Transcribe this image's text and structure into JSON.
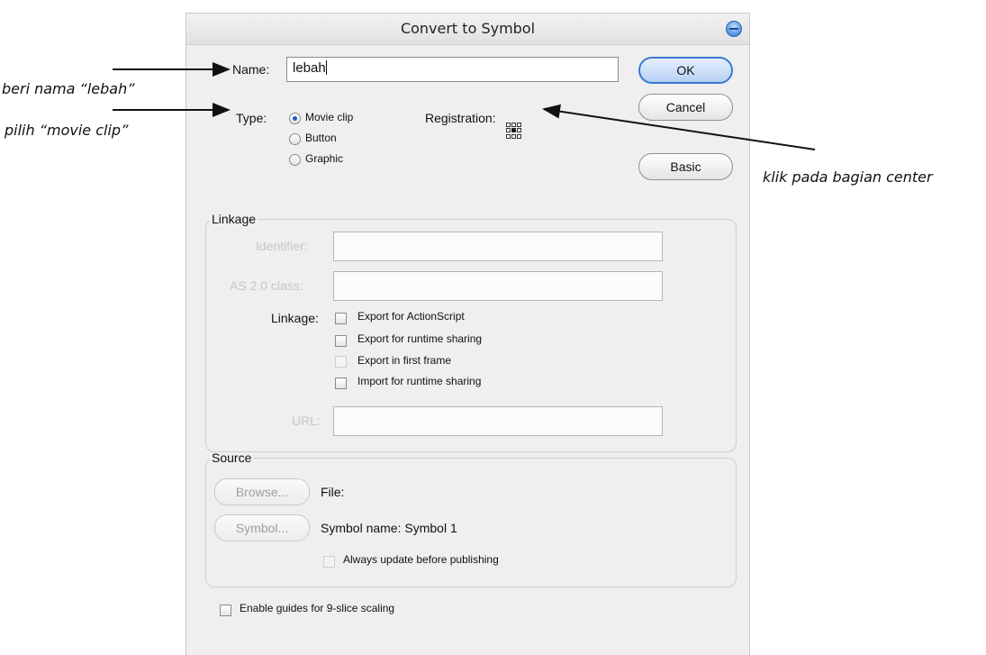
{
  "annotations": {
    "name_hint": "beri nama “lebah”",
    "type_hint": "pilih “movie clip”",
    "registration_hint": "klik pada bagian center"
  },
  "dialog": {
    "title": "Convert to Symbol",
    "name_label": "Name:",
    "name_value": "lebah",
    "type_label": "Type:",
    "type_options": [
      "Movie clip",
      "Button",
      "Graphic"
    ],
    "type_selected": "Movie clip",
    "registration_label": "Registration:",
    "registration_selected": "center",
    "buttons": {
      "ok": "OK",
      "cancel": "Cancel",
      "basic": "Basic"
    }
  },
  "linkage": {
    "legend": "Linkage",
    "identifier_label": "Identifier:",
    "as2_label": "AS 2.0 class:",
    "linkage_label": "Linkage:",
    "options": [
      "Export for ActionScript",
      "Export for runtime sharing",
      "Export in first frame",
      "Import for runtime sharing"
    ],
    "url_label": "URL:"
  },
  "source": {
    "legend": "Source",
    "browse_button": "Browse...",
    "file_label": "File:",
    "symbol_button": "Symbol...",
    "symbol_name": "Symbol name: Symbol 1",
    "always_update": "Always update before publishing"
  },
  "footer": {
    "nine_slice": "Enable guides for 9-slice scaling"
  },
  "colors": {
    "accent": "#3b7ad0",
    "dialog_bg": "#efefef"
  }
}
